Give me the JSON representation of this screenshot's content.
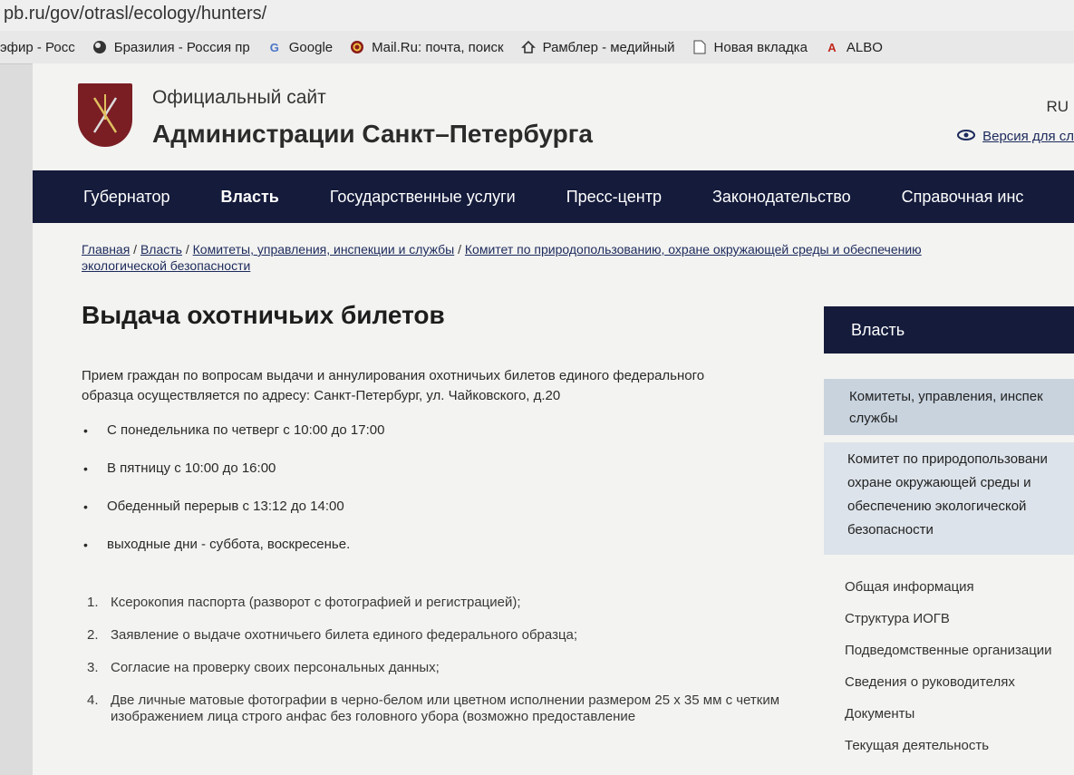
{
  "browser": {
    "url": "pb.ru/gov/otrasl/ecology/hunters/",
    "bookmarks": [
      {
        "label": "эфир - Росс",
        "icon": "none"
      },
      {
        "label": "Бразилия - Россия пр",
        "icon": "globe-icon"
      },
      {
        "label": "Google",
        "icon": "google-icon"
      },
      {
        "label": "Mail.Ru: почта, поиск",
        "icon": "mailru-icon"
      },
      {
        "label": "Рамблер - медийный",
        "icon": "home-icon"
      },
      {
        "label": "Новая вкладка",
        "icon": "page-icon"
      },
      {
        "label": "ALBO",
        "icon": "albo-icon"
      }
    ]
  },
  "header": {
    "subtitle": "Официальный сайт",
    "title": "Администрации Санкт–Петербурга",
    "lang": "RU",
    "vision_link": "Версия для сл"
  },
  "nav": {
    "items": [
      {
        "label": "Губернатор"
      },
      {
        "label": "Власть"
      },
      {
        "label": "Государственные услуги"
      },
      {
        "label": "Пресс-центр"
      },
      {
        "label": "Законодательство"
      },
      {
        "label": "Справочная инс"
      }
    ]
  },
  "breadcrumb": {
    "items": [
      "Главная",
      "Власть",
      "Комитеты, управления, инспекции и службы",
      "Комитет по природопользованию, охране окружающей среды и обеспечению экологической безопасности"
    ],
    "separator": " / "
  },
  "main": {
    "title": "Выдача охотничьих билетов",
    "intro_line1": "Прием граждан по вопросам выдачи и аннулирования охотничьих билетов единого федерального",
    "intro_line2": "образца осуществляется по адресу: Санкт-Петербург, ул. Чайковского, д.20",
    "schedule": [
      "С понедельника по четверг с 10:00 до 17:00",
      "В пятницу с 10:00 до 16:00",
      "Обеденный перерыв с 13:12 до 14:00",
      "выходные дни - суббота, воскресенье."
    ],
    "documents": [
      {
        "num": "1.",
        "text": "Ксерокопия паспорта (разворот с фотографией и регистрацией);"
      },
      {
        "num": "2.",
        "text": "Заявление о выдаче охотничьего билета единого федерального образца;"
      },
      {
        "num": "3.",
        "text": "Согласие на проверку своих персональных данных;"
      },
      {
        "num": "4.",
        "text": "Две личные матовые фотографии в черно-белом или цветном исполнении размером 25 х 35 мм с четким изображением лица строго анфас без головного убора (возможно предоставление"
      }
    ]
  },
  "sidebar": {
    "heading": "Власть",
    "section_line1": "Комитеты, управления, инспек",
    "section_line2": "службы",
    "current_lines": [
      "Комитет по природопользовани",
      "охране окружающей среды и",
      "обеспечению экологической",
      "безопасности"
    ],
    "links": [
      "Общая информация",
      "Структура ИОГВ",
      "Подведомственные организации",
      "Сведения о руководителях",
      "Документы",
      "Текущая деятельность"
    ]
  }
}
